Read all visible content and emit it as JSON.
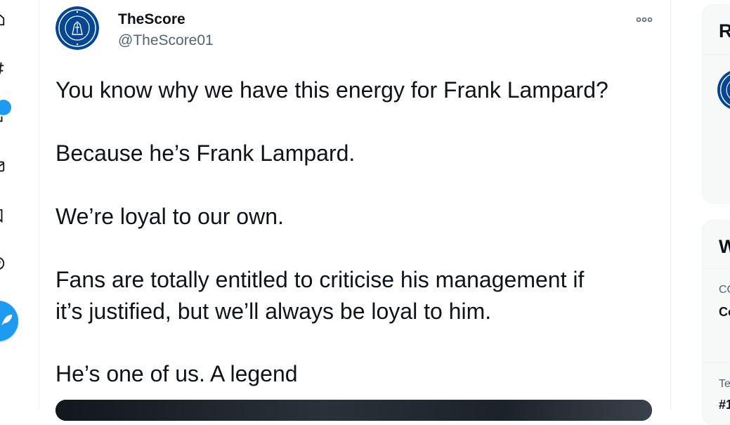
{
  "nav": {
    "icons": [
      "home-icon",
      "explore-icon",
      "notifications-icon",
      "messages-icon",
      "bookmarks-icon",
      "lists-icon",
      "profile-icon",
      "more-icon"
    ],
    "tweet_button_icon": "feather-icon"
  },
  "tweet": {
    "author": {
      "display_name": "TheScore",
      "handle": "@TheScore01",
      "avatar": "chelsea-crest"
    },
    "more_icon": "more-icon",
    "lines": [
      "You know why we have this energy for Frank Lampard?",
      "Because he’s Frank Lampard.",
      "We’re loyal to our own.",
      "Fans are totally entitled to criticise his management if",
      "it’s justified, but we’ll always be loyal to him.",
      "He’s one of us. A legend"
    ]
  },
  "sidebar": {
    "card1": {
      "title": "R",
      "avatar": "chelsea-crest"
    },
    "card2": {
      "title": "W",
      "item1": {
        "meta": "CO",
        "title": "Co"
      },
      "item2": {
        "meta": "Te",
        "title": "#1"
      }
    }
  },
  "colors": {
    "accent": "#1d9bf0",
    "text": "#0f1419",
    "secondary": "#536471",
    "chelsea_blue": "#034694"
  }
}
